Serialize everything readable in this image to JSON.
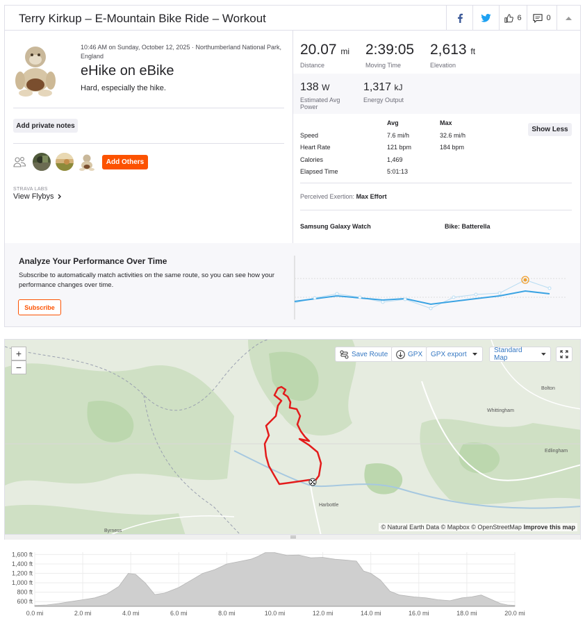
{
  "header": {
    "title": "Terry Kirkup – E-Mountain Bike Ride – Workout",
    "kudos_count": "6",
    "comments_count": "0"
  },
  "activity": {
    "datetime": "10:46 AM on Sunday, October 12, 2025 · Northumberland National Park, England",
    "name": "eHike on eBike",
    "description": "Hard, especially the hike.",
    "private_notes_label": "Add private notes",
    "add_others_label": "Add Others",
    "flyby_kicker": "STRAVA LABS",
    "flyby_label": "View Flybys"
  },
  "stats": {
    "distance": {
      "value": "20.07",
      "unit": "mi",
      "label": "Distance"
    },
    "moving_time": {
      "value": "2:39:05",
      "label": "Moving Time"
    },
    "elevation": {
      "value": "2,613",
      "unit": "ft",
      "label": "Elevation"
    },
    "power": {
      "value": "138",
      "unit": "W",
      "label": "Estimated Avg Power"
    },
    "energy": {
      "value": "1,317",
      "unit": "kJ",
      "label": "Energy Output"
    },
    "show_less_label": "Show Less",
    "col_avg": "Avg",
    "col_max": "Max",
    "rows": [
      {
        "label": "Speed",
        "avg": "7.6 mi/h",
        "max": "32.6 mi/h"
      },
      {
        "label": "Heart Rate",
        "avg": "121 bpm",
        "max": "184 bpm"
      },
      {
        "label": "Calories",
        "avg": "1,469",
        "max": ""
      },
      {
        "label": "Elapsed Time",
        "avg": "5:01:13",
        "max": ""
      }
    ],
    "exertion_label": "Perceived Exertion:",
    "exertion_value": "Max Effort",
    "device": "Samsung Galaxy Watch",
    "bike_label": "Bike:",
    "bike_value": "Batterella"
  },
  "promo": {
    "title": "Analyze Your Performance Over Time",
    "text": "Subscribe to automatically match activities on the same route, so you can see how your performance changes over time.",
    "button": "Subscribe"
  },
  "map": {
    "save_route": "Save Route",
    "gpx": "GPX",
    "gpx_export": "GPX export",
    "map_style": "Standard Map",
    "attribution": "© Natural Earth Data © Mapbox © OpenStreetMap",
    "improve": "Improve this map",
    "places": [
      "Bolton",
      "Whittingham",
      "Edlingham",
      "Harbottle",
      "Byrness"
    ],
    "route_color": "#e31b1b"
  },
  "chart_data": {
    "type": "area",
    "x_ticks": [
      "0.0 mi",
      "2.0 mi",
      "4.0 mi",
      "6.0 mi",
      "8.0 mi",
      "10.0 mi",
      "12.0 mi",
      "14.0 mi",
      "16.0 mi",
      "18.0 mi",
      "20.0 mi"
    ],
    "y_ticks": [
      "1,600 ft",
      "1,400 ft",
      "1,200 ft",
      "1,000 ft",
      "800 ft",
      "600 ft"
    ],
    "ylim": [
      500,
      1650
    ],
    "xlim": [
      0,
      20
    ],
    "x": [
      0,
      0.5,
      1,
      1.5,
      2,
      2.5,
      3,
      3.5,
      3.9,
      4.2,
      4.6,
      5.0,
      5.4,
      6.0,
      6.5,
      7.0,
      7.5,
      8.0,
      8.5,
      9.0,
      9.3,
      9.6,
      10.0,
      10.5,
      11.0,
      11.5,
      12.0,
      12.5,
      13.0,
      13.4,
      13.7,
      14.0,
      14.4,
      14.8,
      15.2,
      15.8,
      16.3,
      16.8,
      17.3,
      17.8,
      18.2,
      18.6,
      19.0,
      19.4,
      19.7,
      20.0
    ],
    "y": [
      520,
      530,
      560,
      600,
      640,
      680,
      760,
      920,
      1200,
      1180,
      1000,
      750,
      780,
      900,
      1050,
      1200,
      1280,
      1400,
      1450,
      1500,
      1560,
      1640,
      1640,
      1580,
      1590,
      1530,
      1540,
      1500,
      1480,
      1460,
      1250,
      1200,
      1060,
      820,
      740,
      700,
      680,
      640,
      620,
      680,
      700,
      740,
      650,
      560,
      530,
      520
    ],
    "fill": "#cfcfcf"
  },
  "colors": {
    "accent": "#fc5200",
    "link": "#3477c2",
    "trend": "#3aa3e3"
  }
}
